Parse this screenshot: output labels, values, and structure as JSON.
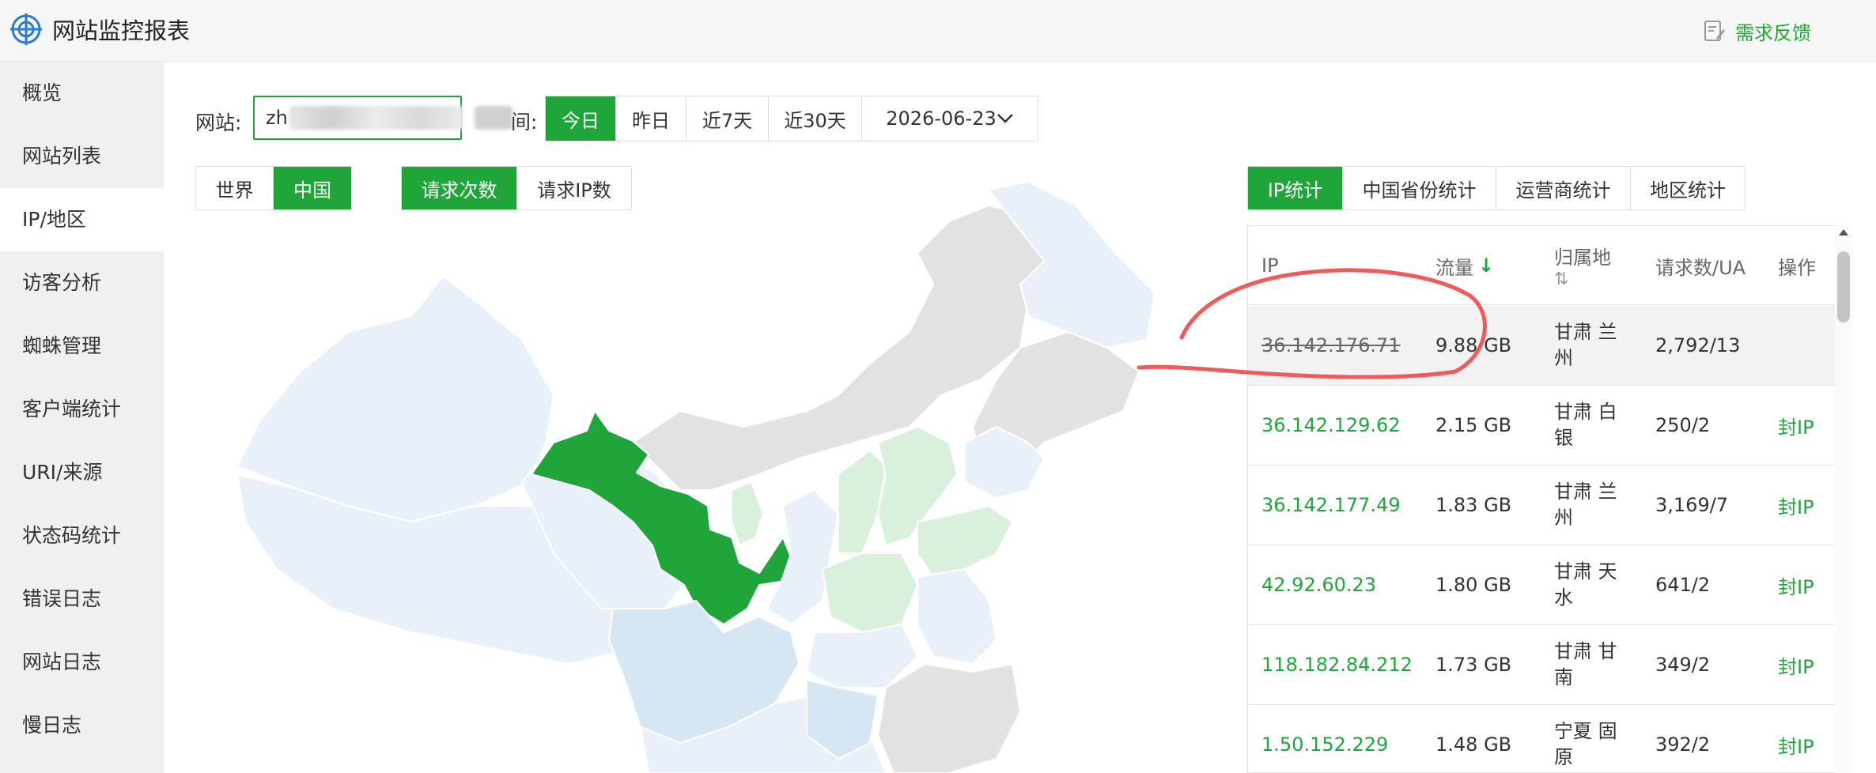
{
  "app": {
    "title": "网站监控报表",
    "feedback_label": "需求反馈",
    "logo_icon": "target-logo-icon",
    "feedback_icon": "edit-note-icon"
  },
  "sidebar": {
    "items": [
      {
        "label": "概览"
      },
      {
        "label": "网站列表"
      },
      {
        "label": "IP/地区",
        "active": true
      },
      {
        "label": "访客分析"
      },
      {
        "label": "蜘蛛管理"
      },
      {
        "label": "客户端统计"
      },
      {
        "label": "URI/来源"
      },
      {
        "label": "状态码统计"
      },
      {
        "label": "错误日志"
      },
      {
        "label": "网站日志"
      },
      {
        "label": "慢日志"
      }
    ]
  },
  "filters": {
    "site_label": "网站:",
    "site_value": "zh",
    "time_label_tail": "间:",
    "date_buttons": [
      "今日",
      "昨日",
      "近7天",
      "近30天"
    ],
    "date_value": "2026-06-23",
    "scope_buttons": [
      "世界",
      "中国"
    ],
    "metric_buttons": [
      "请求次数",
      "请求IP数"
    ]
  },
  "stat_tabs": [
    "IP统计",
    "中国省份统计",
    "运营商统计",
    "地区统计"
  ],
  "table": {
    "headers": {
      "ip": "IP",
      "traffic": "流量",
      "traffic_sort": "↓",
      "location": "归属地",
      "location_sort": "⇅",
      "requests": "请求数/UA",
      "action": "操作"
    },
    "rows": [
      {
        "ip": "36.142.176.71",
        "traffic": "9.88 GB",
        "location": "甘肃 兰州",
        "requests": "2,792/13",
        "action": ""
      },
      {
        "ip": "36.142.129.62",
        "traffic": "2.15 GB",
        "location": "甘肃 白银",
        "requests": "250/2",
        "action": "封IP"
      },
      {
        "ip": "36.142.177.49",
        "traffic": "1.83 GB",
        "location": "甘肃 兰州",
        "requests": "3,169/7",
        "action": "封IP"
      },
      {
        "ip": "42.92.60.23",
        "traffic": "1.80 GB",
        "location": "甘肃 天水",
        "requests": "641/2",
        "action": "封IP"
      },
      {
        "ip": "118.182.84.212",
        "traffic": "1.73 GB",
        "location": "甘肃 甘南",
        "requests": "349/2",
        "action": "封IP"
      },
      {
        "ip": "1.50.152.229",
        "traffic": "1.48 GB",
        "location": "宁夏 固原",
        "requests": "392/2",
        "action": "封IP"
      }
    ]
  },
  "colors": {
    "accent": "#20a53a",
    "map_highlight": "#20a53a",
    "map_light_green": "#d8f0dc",
    "map_light_blue": "#e8f1fa",
    "map_blue_medium": "#d6e6f2",
    "map_gray": "#e2e2e2",
    "annotation_red": "#f05a5a"
  }
}
